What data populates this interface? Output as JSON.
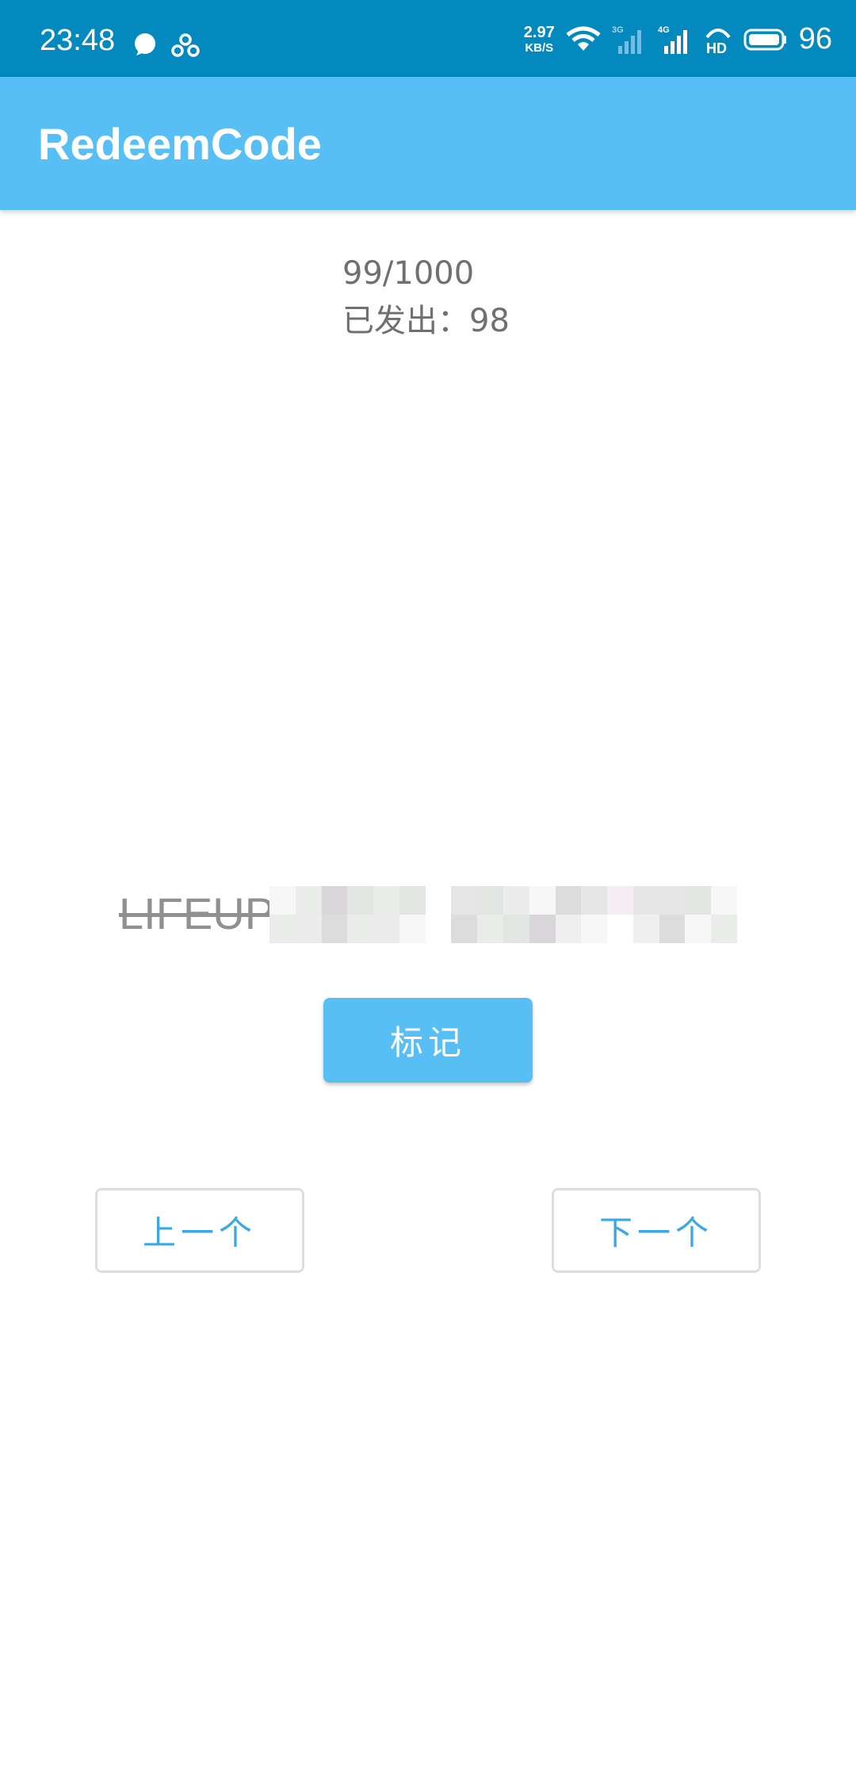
{
  "status_bar": {
    "time": "23:48",
    "left_icons": [
      "chat-bubble-icon",
      "link-icon"
    ],
    "net_speed_value": "2.97",
    "net_speed_unit": "KB/S",
    "signal_labels": [
      "3G",
      "4G"
    ],
    "hd_label": "HD",
    "battery_level": "96"
  },
  "app_bar": {
    "title": "RedeemCode",
    "color": "#57bff3"
  },
  "main": {
    "counter": "99/1000",
    "issued": "已发出：98",
    "code_prefix": "LIFEUP",
    "mark_button": "标记",
    "prev_button": "上一个",
    "next_button": "下一个",
    "accent_color": "#57bff3"
  }
}
